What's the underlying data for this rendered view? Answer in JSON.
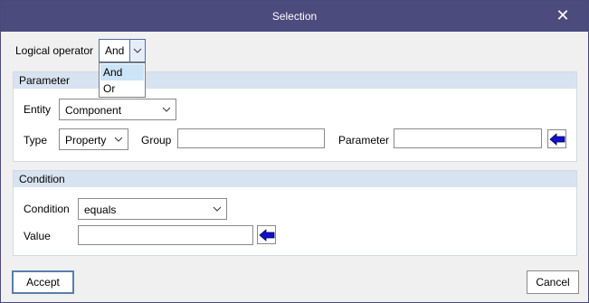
{
  "window": {
    "title": "Selection"
  },
  "logical": {
    "label": "Logical operator",
    "value": "And",
    "options": [
      "And",
      "Or"
    ]
  },
  "parameter": {
    "header": "Parameter",
    "entity_label": "Entity",
    "entity_value": "Component",
    "type_label": "Type",
    "type_value": "Property",
    "group_label": "Group",
    "group_value": "",
    "param_label": "Parameter",
    "param_value": ""
  },
  "condition": {
    "header": "Condition",
    "cond_label": "Condition",
    "cond_value": "equals",
    "value_label": "Value",
    "value_value": ""
  },
  "buttons": {
    "accept": "Accept",
    "cancel": "Cancel"
  },
  "colors": {
    "titlebar": "#4b4b7d",
    "group_header": "#d8e3f1",
    "arrow_blue": "#1010c8",
    "dropdown_highlight": "#cce4f7"
  }
}
